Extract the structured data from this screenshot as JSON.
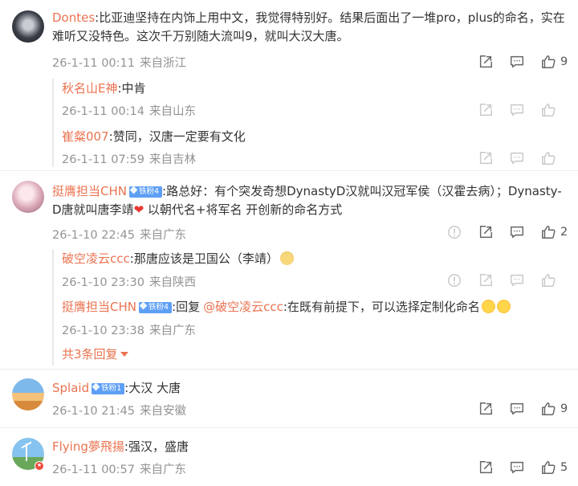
{
  "comments": [
    {
      "user": "Dontes",
      "text": "比亚迪坚持在内饰上用中文，我觉得特别好。结果后面出了一堆pro，plus的命名，实在难听又没特色。这次千万别随大流叫9，就叫大汉大唐。",
      "date": "26-1-11 00:11",
      "location": "来自浙江",
      "likes": "9",
      "replies": [
        {
          "user": "秋名山E神",
          "text": "中肯",
          "date": "26-1-11 00:14",
          "location": "来自山东"
        },
        {
          "user": "崔粲007",
          "text": "赞同，汉唐一定要有文化",
          "date": "26-1-11 07:59",
          "location": "来自吉林"
        }
      ]
    },
    {
      "user": "挺膺担当CHN",
      "fan_badge": "铁粉4",
      "text": "路总好：有个突发奇想DynastyD汉就叫汉冠军侯（汉霍去病）；Dynasty-D唐就叫唐李靖",
      "text_tail": " 以朝代名+将军名 开创新的命名方式",
      "date": "26-1-10 22:45",
      "location": "来自广东",
      "likes": "2",
      "replies": [
        {
          "user": "破空凌云ccc",
          "text": "那唐应该是卫国公（李靖）",
          "date": "26-1-10 23:30",
          "location": "来自陕西"
        },
        {
          "user": "挺膺担当CHN",
          "fan_badge": "铁粉4",
          "reply_prefix": "回复",
          "reply_to": "@破空凌云ccc",
          "text": "在既有前提下，可以选择定制化命名",
          "date": "26-1-10 23:38",
          "location": "来自广东"
        }
      ],
      "more_replies": "共3条回复"
    },
    {
      "user": "Splaid",
      "fan_badge": "铁粉1",
      "text": "大汉 大唐",
      "date": "26-1-10 21:45",
      "location": "来自安徽",
      "likes": "9"
    },
    {
      "user": "Flying夢飛揚",
      "text": "强汉，盛唐",
      "date": "26-1-11 00:57",
      "location": "来自广东",
      "likes": "5"
    }
  ],
  "colors": {
    "username": "#eb7350",
    "meta": "#939393",
    "fan_badge": "#5d9ff5"
  }
}
